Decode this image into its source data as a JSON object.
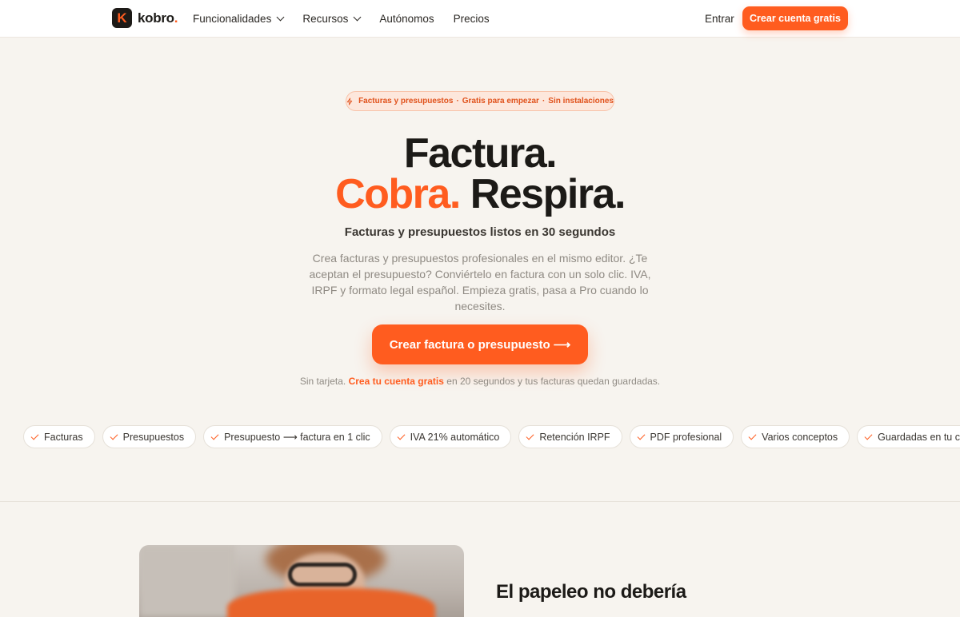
{
  "header": {
    "logo_letter": "K",
    "logo_text": "kobro",
    "logo_dot": ".",
    "nav": [
      {
        "label": "Funcionalidades",
        "has_dropdown": true
      },
      {
        "label": "Recursos",
        "has_dropdown": true
      },
      {
        "label": "Autónomos",
        "has_dropdown": false
      },
      {
        "label": "Precios",
        "has_dropdown": false
      }
    ],
    "login_label": "Entrar",
    "cta_label": "Crear cuenta gratis"
  },
  "hero": {
    "badge": {
      "icon": "bolt-icon",
      "parts": [
        "Facturas y presupuestos",
        "·",
        "Gratis para empezar",
        "·",
        "Sin instalaciones"
      ]
    },
    "headline_line1": "Factura.",
    "headline_accent": "Cobra.",
    "headline_rest": " Respira.",
    "subheadline": "Facturas y presupuestos listos en 30 segundos",
    "description": "Crea facturas y presupuestos profesionales en el mismo editor. ¿Te aceptan el presupuesto? Conviértelo en factura con un solo clic. IVA, IRPF y formato legal español. Empieza gratis, pasa a Pro cuando lo necesites.",
    "cta_label": "Crear factura o presupuesto ⟶",
    "note_before": "Sin tarjeta. ",
    "note_link": "Crea tu cuenta gratis",
    "note_after": " en 20 segundos y tus facturas quedan guardadas."
  },
  "features": [
    "Facturas",
    "Presupuestos",
    "Presupuesto ⟶ factura en 1 clic",
    "IVA 21% automático",
    "Retención IRPF",
    "PDF profesional",
    "Varios conceptos",
    "Guardadas en tu cuenta"
  ],
  "section2": {
    "title": "El papeleo no debería"
  },
  "colors": {
    "accent": "#ff5c1f",
    "background": "#f7f4ef",
    "text": "#1c1a17",
    "muted": "#8f8a83"
  }
}
